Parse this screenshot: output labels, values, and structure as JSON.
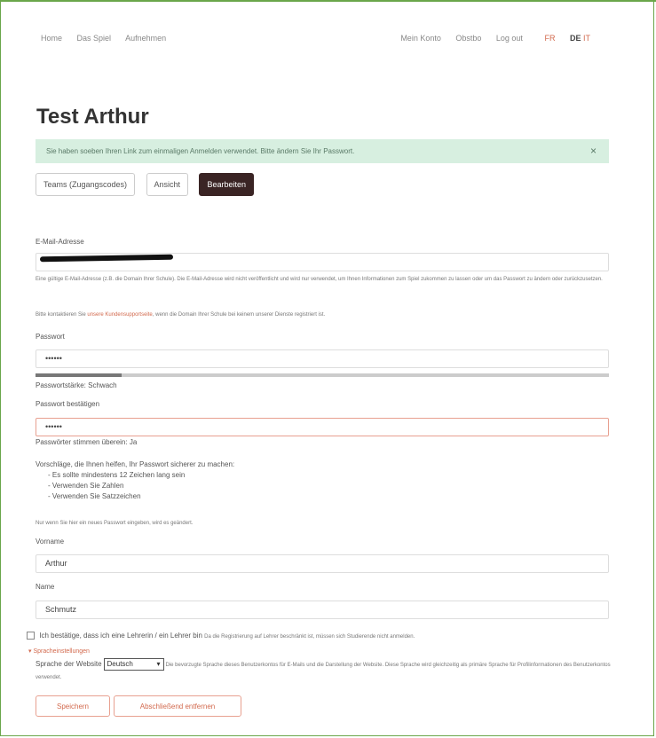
{
  "nav": {
    "left": [
      "Home",
      "Das Spiel",
      "Aufnehmen"
    ],
    "right": [
      "Mein Konto",
      "Obstbo",
      "Log out"
    ],
    "lang_fr": "FR",
    "lang_de": "DE",
    "lang_it": "IT"
  },
  "title": "Test Arthur",
  "alert": "Sie haben soeben Ihren Link zum einmaligen Anmelden verwendet. Bitte ändern Sie Ihr Passwort.",
  "tabs": [
    "Teams (Zugangscodes)",
    "Ansicht",
    "Bearbeiten"
  ],
  "email": {
    "label": "E-Mail-Adresse",
    "hint1": "Eine gültige E-Mail-Adresse (z.B. die Domain Ihrer Schule). Die E-Mail-Adresse wird nicht veröffentlicht und wird nur verwendet, um Ihnen Informationen zum Spiel zukommen zu lassen oder um das Passwort zu ändern oder zurückzusetzen.",
    "hint2_pre": "Bitte kontaktieren Sie",
    "hint2_link": "unsere Kundensupportseite",
    "hint2_post": "wenn die Domain Ihrer Schule bei keinem unserer Dienste registriert ist."
  },
  "password": {
    "label": "Passwort",
    "value": "••••••",
    "strength_level": 0.15,
    "strength_label": "Passwortstärke: Schwach"
  },
  "confirm": {
    "label": "Passwort bestätigen",
    "value": "••••••",
    "match": "Passwörter stimmen überein: Ja"
  },
  "suggestions": {
    "title": "Vorschläge, die Ihnen helfen, Ihr Passwort sicherer zu machen:",
    "items": [
      "Es sollte mindestens 12 Zeichen lang sein",
      "Verwenden Sie Zahlen",
      "Verwenden Sie Satzzeichen"
    ]
  },
  "change_hint": "Nur wenn Sie hier ein neues Passwort eingeben, wird es geändert.",
  "firstname": {
    "label": "Vorname",
    "value": "Arthur"
  },
  "lastname": {
    "label": "Name",
    "value": "Schmutz"
  },
  "teacher_check": {
    "label": "Ich bestätige, dass ich eine Lehrerin / ein Lehrer bin",
    "note": "Da die Registrierung auf Lehrer beschränkt ist, müssen sich Studierende nicht anmelden."
  },
  "language_settings": "Spracheinstellungen",
  "site_language": {
    "label": "Sprache der Website",
    "value": "Deutsch",
    "note": "Die bevorzugte Sprache dieses Benutzerkontos für E-Mails und die Darstellung der Website. Diese Sprache wird gleichzeitig als primäre Sprache für Profilinformationen des Benutzerkontos verwendet."
  },
  "buttons": {
    "save": "Speichern",
    "delete": "Abschließend entfernen"
  }
}
